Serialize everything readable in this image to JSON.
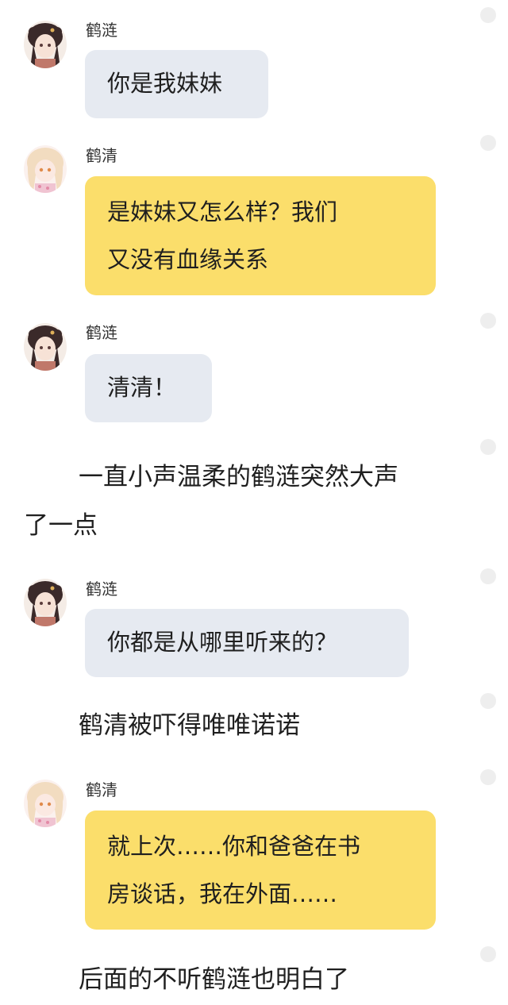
{
  "messages": [
    {
      "type": "chat",
      "speaker": "鹤涟",
      "avatar": "heliam-avatar",
      "bubble_color": "#e6eaf1",
      "lines": [
        "你是我妹妹"
      ]
    },
    {
      "type": "chat",
      "speaker": "鹤清",
      "avatar": "heqing-avatar",
      "bubble_color": "#fbde6b",
      "lines": [
        "是妹妹又怎么样？我们",
        "又没有血缘关系"
      ]
    },
    {
      "type": "chat",
      "speaker": "鹤涟",
      "avatar": "helian-avatar",
      "bubble_color": "#e6eaf1",
      "lines": [
        "清清！"
      ]
    },
    {
      "type": "narration",
      "lines": [
        "一直小声温柔的鹤涟突然大声",
        "了一点"
      ]
    },
    {
      "type": "chat",
      "speaker": "鹤涟",
      "avatar": "helian-avatar",
      "bubble_color": "#e6eaf1",
      "lines": [
        "你都是从哪里听来的？"
      ]
    },
    {
      "type": "narration",
      "lines": [
        "鹤清被吓得唯唯诺诺"
      ]
    },
    {
      "type": "chat",
      "speaker": "鹤清",
      "avatar": "heqing-avatar",
      "bubble_color": "#fbde6b",
      "lines": [
        "就上次……你和爸爸在书",
        "房谈话，我在外面……"
      ]
    },
    {
      "type": "narration",
      "lines": [
        "后面的不听鹤涟也明白了"
      ]
    }
  ]
}
